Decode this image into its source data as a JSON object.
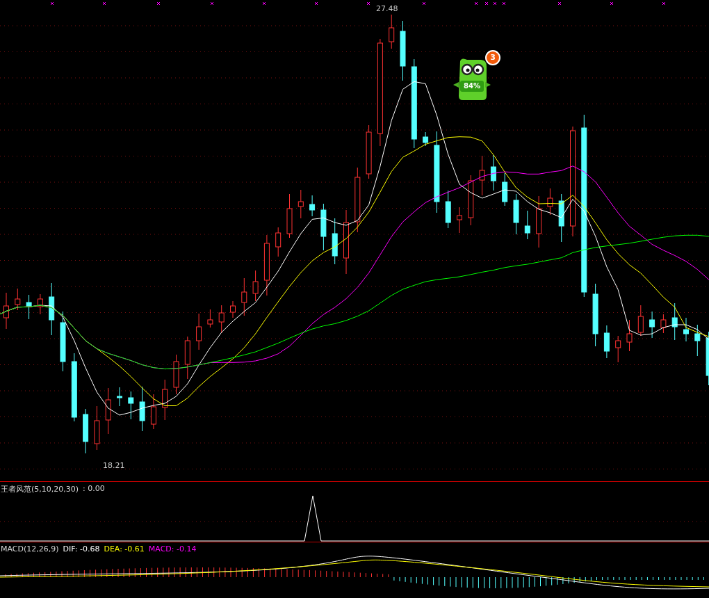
{
  "main_panel": {
    "high_label": "27.48",
    "low_label": "18.21"
  },
  "mascot": {
    "badge": "3",
    "reading": "84%"
  },
  "indicator_panel": {
    "title": "王者风范(5,10,20,30)",
    "value": ": 0.00"
  },
  "macd_panel": {
    "name": "MACD(12,26,9)",
    "items": [
      {
        "text": "DIF: -0.68",
        "color": "#ffffff"
      },
      {
        "text": "DEA: -0.61",
        "color": "#ffff00"
      },
      {
        "text": "MACD: -0.14",
        "color": "#ff00ff"
      }
    ]
  }
}
